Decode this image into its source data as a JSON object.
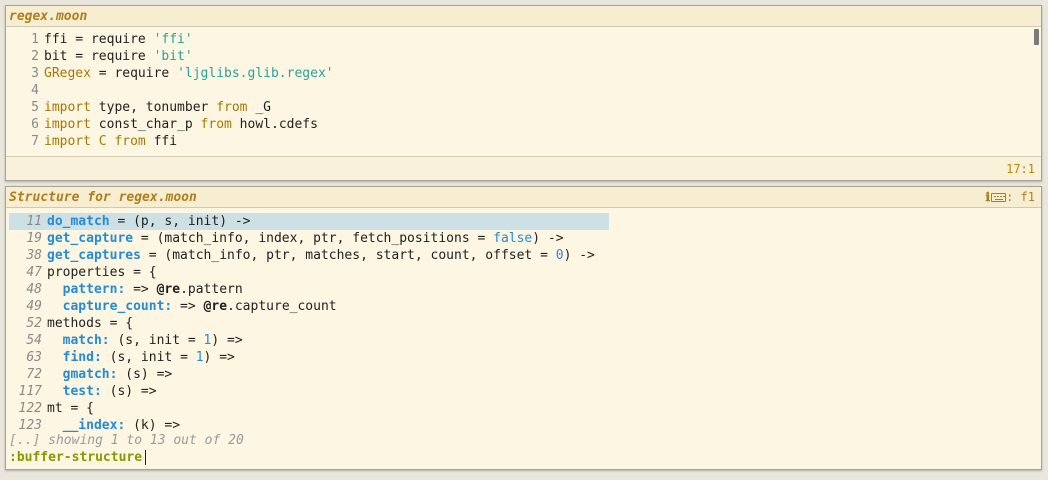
{
  "editor": {
    "title": "regex.moon",
    "cursor_position": "17:1",
    "lines": [
      {
        "no": "1",
        "tokens": [
          {
            "t": "ffi = require ",
            "c": ""
          },
          {
            "t": "'ffi'",
            "c": "str"
          }
        ]
      },
      {
        "no": "2",
        "tokens": [
          {
            "t": "bit = require ",
            "c": ""
          },
          {
            "t": "'bit'",
            "c": "str"
          }
        ]
      },
      {
        "no": "3",
        "tokens": [
          {
            "t": "GRegex",
            "c": "kw"
          },
          {
            "t": " = require ",
            "c": ""
          },
          {
            "t": "'ljglibs.glib.regex'",
            "c": "str"
          }
        ]
      },
      {
        "no": "4",
        "tokens": []
      },
      {
        "no": "5",
        "tokens": [
          {
            "t": "import",
            "c": "kw"
          },
          {
            "t": " type, tonumber ",
            "c": ""
          },
          {
            "t": "from",
            "c": "kw"
          },
          {
            "t": " _G",
            "c": ""
          }
        ]
      },
      {
        "no": "6",
        "tokens": [
          {
            "t": "import",
            "c": "kw"
          },
          {
            "t": " const_char_p ",
            "c": ""
          },
          {
            "t": "from",
            "c": "kw"
          },
          {
            "t": " howl.cdefs",
            "c": ""
          }
        ]
      },
      {
        "no": "7",
        "tokens": [
          {
            "t": "import",
            "c": "kw"
          },
          {
            "t": " ",
            "c": ""
          },
          {
            "t": "C",
            "c": "kw"
          },
          {
            "t": " ",
            "c": ""
          },
          {
            "t": "from",
            "c": "kw"
          },
          {
            "t": " ffi",
            "c": ""
          }
        ]
      }
    ]
  },
  "structure": {
    "title": "Structure for regex.moon",
    "info_icon": "ℹ",
    "keyboard_icon": "keyboard-icon",
    "shortcut": ": f1",
    "items": [
      {
        "no": "11",
        "selected": true,
        "tokens": [
          {
            "t": "do_match",
            "c": "fn"
          },
          {
            "t": " = (p, s, init) ->",
            "c": ""
          }
        ]
      },
      {
        "no": "19",
        "tokens": [
          {
            "t": "get_capture",
            "c": "fn"
          },
          {
            "t": " = (match_info, index, ptr, fetch_positions = ",
            "c": ""
          },
          {
            "t": "false",
            "c": "bool"
          },
          {
            "t": ") ->",
            "c": ""
          }
        ]
      },
      {
        "no": "38",
        "tokens": [
          {
            "t": "get_captures",
            "c": "fn"
          },
          {
            "t": " = (match_info, ptr, matches, start, count, offset = ",
            "c": ""
          },
          {
            "t": "0",
            "c": "num"
          },
          {
            "t": ") ->",
            "c": ""
          }
        ]
      },
      {
        "no": "47",
        "tokens": [
          {
            "t": "properties = {",
            "c": ""
          }
        ]
      },
      {
        "no": "48",
        "tokens": [
          {
            "t": "  ",
            "c": ""
          },
          {
            "t": "pattern:",
            "c": "fn"
          },
          {
            "t": " => ",
            "c": ""
          },
          {
            "t": "@re",
            "c": "selfref"
          },
          {
            "t": ".pattern",
            "c": ""
          }
        ]
      },
      {
        "no": "49",
        "tokens": [
          {
            "t": "  ",
            "c": ""
          },
          {
            "t": "capture_count:",
            "c": "fn"
          },
          {
            "t": " => ",
            "c": ""
          },
          {
            "t": "@re",
            "c": "selfref"
          },
          {
            "t": ".capture_count",
            "c": ""
          }
        ]
      },
      {
        "no": "52",
        "tokens": [
          {
            "t": "methods = {",
            "c": ""
          }
        ]
      },
      {
        "no": "54",
        "tokens": [
          {
            "t": "  ",
            "c": ""
          },
          {
            "t": "match:",
            "c": "fn"
          },
          {
            "t": " (s, init = ",
            "c": ""
          },
          {
            "t": "1",
            "c": "num"
          },
          {
            "t": ") =>",
            "c": ""
          }
        ]
      },
      {
        "no": "63",
        "tokens": [
          {
            "t": "  ",
            "c": ""
          },
          {
            "t": "find:",
            "c": "fn"
          },
          {
            "t": " (s, init = ",
            "c": ""
          },
          {
            "t": "1",
            "c": "num"
          },
          {
            "t": ") =>",
            "c": ""
          }
        ]
      },
      {
        "no": "72",
        "tokens": [
          {
            "t": "  ",
            "c": ""
          },
          {
            "t": "gmatch:",
            "c": "fn"
          },
          {
            "t": " (s) =>",
            "c": ""
          }
        ]
      },
      {
        "no": "117",
        "tokens": [
          {
            "t": "  ",
            "c": ""
          },
          {
            "t": "test:",
            "c": "fn"
          },
          {
            "t": " (s) =>",
            "c": ""
          }
        ]
      },
      {
        "no": "122",
        "tokens": [
          {
            "t": "mt = {",
            "c": ""
          }
        ]
      },
      {
        "no": "123",
        "tokens": [
          {
            "t": "  ",
            "c": ""
          },
          {
            "t": "__index:",
            "c": "fn"
          },
          {
            "t": " (k) =>",
            "c": ""
          }
        ]
      }
    ],
    "footer": "[..] showing 1 to 13 out of 20",
    "command": ":buffer-structure"
  }
}
